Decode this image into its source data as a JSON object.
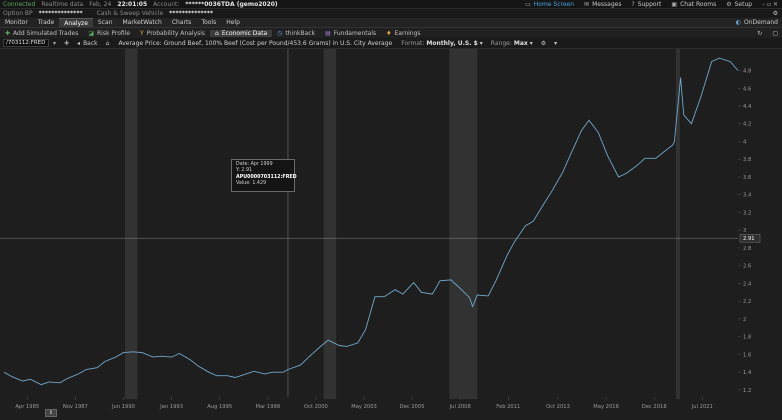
{
  "status_bar": {
    "connected": "Connected",
    "realtime": "Realtime data",
    "date": "Feb, 24",
    "time": "22:01:05",
    "account_label": "Account:",
    "account_value": "******0036TDA (gemo2020)",
    "home_screen": "Home Screen",
    "messages": "Messages",
    "support": "Support",
    "chat_rooms": "Chat Rooms",
    "setup": "Setup"
  },
  "account_bar": {
    "option_bp_label": "Option BP",
    "option_bp_value": "**************",
    "cash_label": "Cash & Sweep Vehicle",
    "cash_value": "**************"
  },
  "menu": {
    "items": [
      "Monitor",
      "Trade",
      "Analyze",
      "Scan",
      "MarketWatch",
      "Charts",
      "Tools",
      "Help"
    ],
    "active_index": 2,
    "ondemand": "OnDemand"
  },
  "toolbar": {
    "items": [
      {
        "label": "Add Simulated Trades",
        "icon": "plus-icon"
      },
      {
        "label": "Risk Profile",
        "icon": "risk-profile-icon"
      },
      {
        "label": "Probability Analysis",
        "icon": "probability-icon"
      },
      {
        "label": "Economic Data",
        "icon": "bank-icon"
      },
      {
        "label": "thinkBack",
        "icon": "clock-icon"
      },
      {
        "label": "Fundamentals",
        "icon": "fundamentals-icon"
      },
      {
        "label": "Earnings",
        "icon": "lightbulb-icon"
      }
    ],
    "active_index": 3
  },
  "chart_header": {
    "symbol": "/703112:FRED",
    "back_label": "Back",
    "title": "Average Price: Ground Beef, 100% Beef (Cost per Pound/453.6 Grams) in U.S. City Average",
    "format_label": "Format:",
    "format_value": "Monthly, U.S. $",
    "range_label": "Range:",
    "range_value": "Max"
  },
  "tooltip": {
    "date": "Date:   Apr 1999",
    "y": "Y:      2.91",
    "series": "APU0000703112:FRED",
    "value": "Value:  1.429"
  },
  "colors": {
    "line": "#6fa8c9",
    "grid": "#2e2e2e",
    "shade": "#3a3a3a",
    "crosshair": "#9a9a9a",
    "label_box": "#2f2f2f"
  },
  "chart_data": {
    "type": "line",
    "series": [
      {
        "color": "#6fa8c9",
        "points": [
          [
            "1984-01",
            1.4
          ],
          [
            "1984-06",
            1.35
          ],
          [
            "1985-01",
            1.3
          ],
          [
            "1985-06",
            1.32
          ],
          [
            "1986-01",
            1.26
          ],
          [
            "1986-06",
            1.29
          ],
          [
            "1987-01",
            1.28
          ],
          [
            "1987-06",
            1.33
          ],
          [
            "1988-01",
            1.38
          ],
          [
            "1988-06",
            1.43
          ],
          [
            "1989-01",
            1.45
          ],
          [
            "1989-06",
            1.52
          ],
          [
            "1990-01",
            1.57
          ],
          [
            "1990-06",
            1.62
          ],
          [
            "1990-12",
            1.63
          ],
          [
            "1991-06",
            1.62
          ],
          [
            "1992-01",
            1.57
          ],
          [
            "1992-06",
            1.58
          ],
          [
            "1993-01",
            1.57
          ],
          [
            "1993-06",
            1.61
          ],
          [
            "1994-01",
            1.54
          ],
          [
            "1994-06",
            1.47
          ],
          [
            "1995-01",
            1.4
          ],
          [
            "1995-06",
            1.36
          ],
          [
            "1996-01",
            1.36
          ],
          [
            "1996-06",
            1.34
          ],
          [
            "1997-01",
            1.38
          ],
          [
            "1997-06",
            1.41
          ],
          [
            "1998-01",
            1.38
          ],
          [
            "1998-06",
            1.4
          ],
          [
            "1999-01",
            1.4
          ],
          [
            "1999-04",
            1.43
          ],
          [
            "1999-12",
            1.48
          ],
          [
            "2000-06",
            1.58
          ],
          [
            "2001-01",
            1.69
          ],
          [
            "2001-06",
            1.76
          ],
          [
            "2002-01",
            1.7
          ],
          [
            "2002-06",
            1.69
          ],
          [
            "2003-01",
            1.73
          ],
          [
            "2003-06",
            1.88
          ],
          [
            "2003-12",
            2.25
          ],
          [
            "2004-06",
            2.25
          ],
          [
            "2005-01",
            2.33
          ],
          [
            "2005-06",
            2.28
          ],
          [
            "2006-01",
            2.41
          ],
          [
            "2006-06",
            2.3
          ],
          [
            "2007-01",
            2.28
          ],
          [
            "2007-06",
            2.43
          ],
          [
            "2008-01",
            2.44
          ],
          [
            "2008-06",
            2.36
          ],
          [
            "2009-01",
            2.24
          ],
          [
            "2009-03",
            2.14
          ],
          [
            "2009-06",
            2.27
          ],
          [
            "2010-01",
            2.26
          ],
          [
            "2010-06",
            2.43
          ],
          [
            "2011-01",
            2.71
          ],
          [
            "2011-06",
            2.87
          ],
          [
            "2012-01",
            3.05
          ],
          [
            "2012-06",
            3.1
          ],
          [
            "2013-01",
            3.3
          ],
          [
            "2013-06",
            3.44
          ],
          [
            "2014-01",
            3.65
          ],
          [
            "2014-06",
            3.85
          ],
          [
            "2015-01",
            4.12
          ],
          [
            "2015-06",
            4.24
          ],
          [
            "2015-12",
            4.1
          ],
          [
            "2016-06",
            3.84
          ],
          [
            "2017-01",
            3.6
          ],
          [
            "2017-06",
            3.64
          ],
          [
            "2018-01",
            3.73
          ],
          [
            "2018-06",
            3.81
          ],
          [
            "2019-01",
            3.81
          ],
          [
            "2019-06",
            3.88
          ],
          [
            "2019-12",
            3.96
          ],
          [
            "2020-01",
            4.0
          ],
          [
            "2020-05",
            4.72
          ],
          [
            "2020-07",
            4.3
          ],
          [
            "2020-12",
            4.2
          ],
          [
            "2021-06",
            4.5
          ],
          [
            "2022-01",
            4.9
          ],
          [
            "2022-06",
            4.94
          ],
          [
            "2023-01",
            4.9
          ],
          [
            "2023-06",
            4.8
          ]
        ]
      }
    ],
    "x_axis": {
      "ticks": [
        "Apr 1985",
        "Nov 1987",
        "Jun 1990",
        "Jan 1993",
        "Aug 1995",
        "Mar 1998",
        "Oct 2000",
        "May 2003",
        "Dec 2005",
        "Jul 2008",
        "Feb 2011",
        "Oct 2013",
        "May 2016",
        "Dec 2018",
        "Jul 2021"
      ],
      "range": [
        "1984-01",
        "2023-06"
      ]
    },
    "y_axis": {
      "ticks": [
        "1.2",
        "1.4",
        "1.6",
        "1.8",
        "2",
        "2.2",
        "2.4",
        "2.6",
        "2.8",
        "3",
        "3.2",
        "3.4",
        "3.6",
        "3.8",
        "4",
        "4.2",
        "4.4",
        "4.6",
        "4.8"
      ],
      "range": [
        1.12,
        5.02
      ],
      "crosshair_value": "2.91"
    },
    "recessions": [
      [
        "1990-07",
        "1991-03"
      ],
      [
        "2001-03",
        "2001-11"
      ],
      [
        "2007-12",
        "2009-06"
      ],
      [
        "2020-02",
        "2020-04"
      ]
    ],
    "grid": false,
    "crosshair": {
      "x": "1999-04",
      "y": 2.91
    }
  }
}
